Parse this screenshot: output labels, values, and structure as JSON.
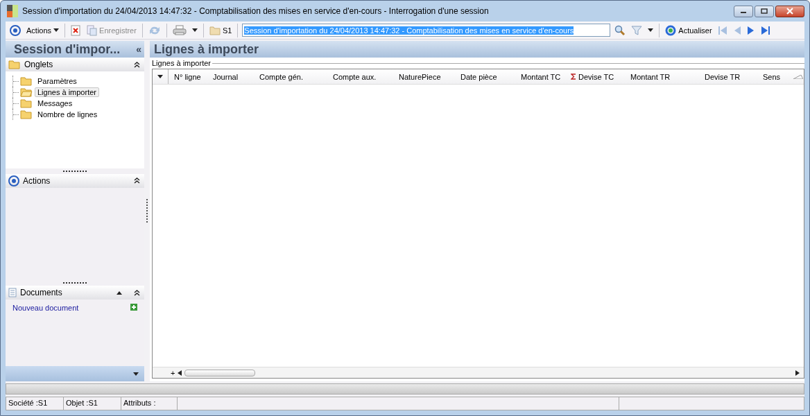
{
  "window": {
    "title": "Session d'importation du 24/04/2013 14:47:32 - Comptabilisation des mises en service d'en-cours -  Interrogation d'une session"
  },
  "toolbar": [
    {
      "kind": "target"
    },
    {
      "kind": "menu",
      "label": "Actions"
    },
    {
      "kind": "sep"
    },
    {
      "kind": "delete"
    },
    {
      "kind": "save",
      "label": "Enregistrer",
      "disabled": true
    },
    {
      "kind": "sep"
    },
    {
      "kind": "refresh",
      "disabled": true
    },
    {
      "kind": "sep"
    },
    {
      "kind": "print"
    },
    {
      "kind": "sep"
    },
    {
      "kind": "folder",
      "label": "S1"
    },
    {
      "kind": "sep"
    },
    {
      "kind": "field",
      "value": "Session d'importation du 24/04/2013 14:47:32 - Comptabilisation des mises en service d'en-cours"
    },
    {
      "kind": "search"
    },
    {
      "kind": "filter"
    },
    {
      "kind": "sep"
    },
    {
      "kind": "reload",
      "label": "Actualiser"
    },
    {
      "kind": "first",
      "disabled": true
    },
    {
      "kind": "prev",
      "disabled": true
    },
    {
      "kind": "next",
      "disabled": false
    },
    {
      "kind": "last",
      "disabled": false
    }
  ],
  "left_panel": {
    "title": "Session d'impor...",
    "collapse": "«",
    "tabs_section": {
      "title": "Onglets",
      "items": [
        {
          "label": "Paramètres",
          "selected": false
        },
        {
          "label": "Lignes à importer",
          "selected": true
        },
        {
          "label": "Messages",
          "selected": false
        },
        {
          "label": "Nombre de lignes",
          "selected": false
        }
      ]
    },
    "actions_section": {
      "title": "Actions"
    },
    "documents_section": {
      "title": "Documents",
      "link": "Nouveau document"
    }
  },
  "main_panel": {
    "title": "Lignes à importer",
    "group_label": "Lignes à importer",
    "columns": [
      {
        "label": "N° ligne",
        "sum": false
      },
      {
        "label": "Journal",
        "sum": false
      },
      {
        "label": "Compte gén.",
        "sum": false
      },
      {
        "label": "Compte aux.",
        "sum": false
      },
      {
        "label": "NaturePiece",
        "sum": false
      },
      {
        "label": "Date pièce",
        "sum": false
      },
      {
        "label": "Montant TC",
        "sum": false
      },
      {
        "label": "Devise TC",
        "sum": true
      },
      {
        "label": "Montant TR",
        "sum": false
      },
      {
        "label": "Devise TR",
        "sum": false
      },
      {
        "label": "Sens",
        "sum": false
      }
    ],
    "add_row": "+"
  },
  "status_bar": [
    "Société :S1",
    "Objet :S1",
    "Attributs :"
  ]
}
